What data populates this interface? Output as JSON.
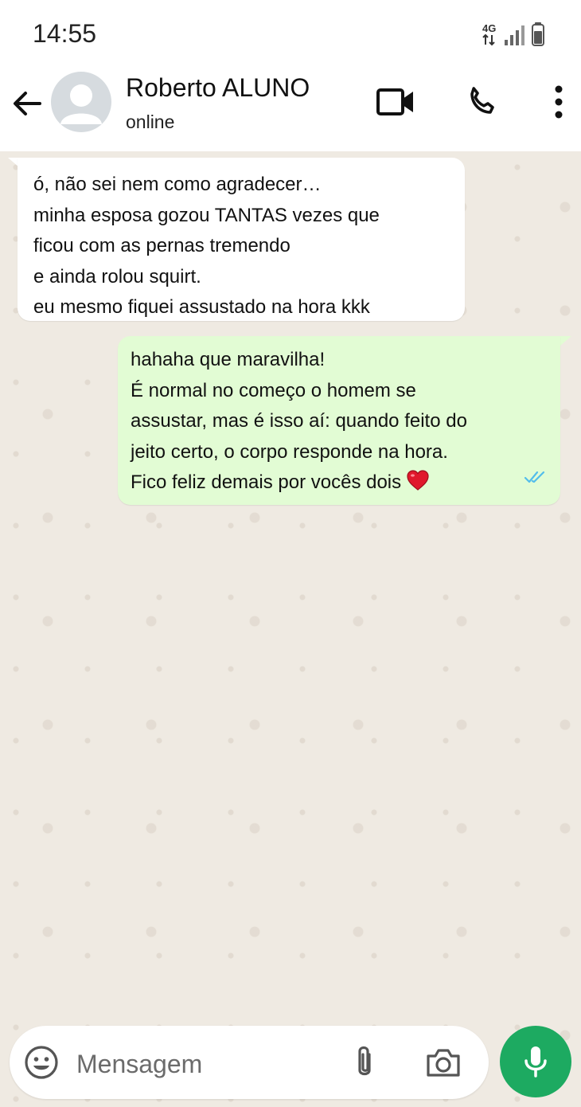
{
  "status_bar": {
    "time": "14:55",
    "network": "4G"
  },
  "header": {
    "contact_name": "Roberto ALUNO",
    "contact_status": "online"
  },
  "messages": [
    {
      "direction": "incoming",
      "lines": [
        "ó, não sei nem como agradecer…",
        "minha esposa gozou TANTAS vezes que",
        "ficou com as pernas tremendo",
        "e ainda rolou squirt.",
        "eu mesmo fiquei assustado na hora kkk"
      ]
    },
    {
      "direction": "outgoing",
      "lines": [
        "hahaha que maravilha!",
        "É normal no começo o homem se",
        "assustar, mas é isso aí: quando feito do",
        "jeito certo, o corpo responde na hora.",
        "Fico feliz demais por vocês dois"
      ],
      "emoji": "heart",
      "status": "read"
    }
  ],
  "composer": {
    "placeholder": "Mensagem"
  },
  "colors": {
    "chat_background": "#efeae2",
    "outgoing_bubble": "#e2fcd4",
    "incoming_bubble": "#ffffff",
    "accent_green": "#1daa61",
    "read_ticks": "#53bdeb"
  }
}
